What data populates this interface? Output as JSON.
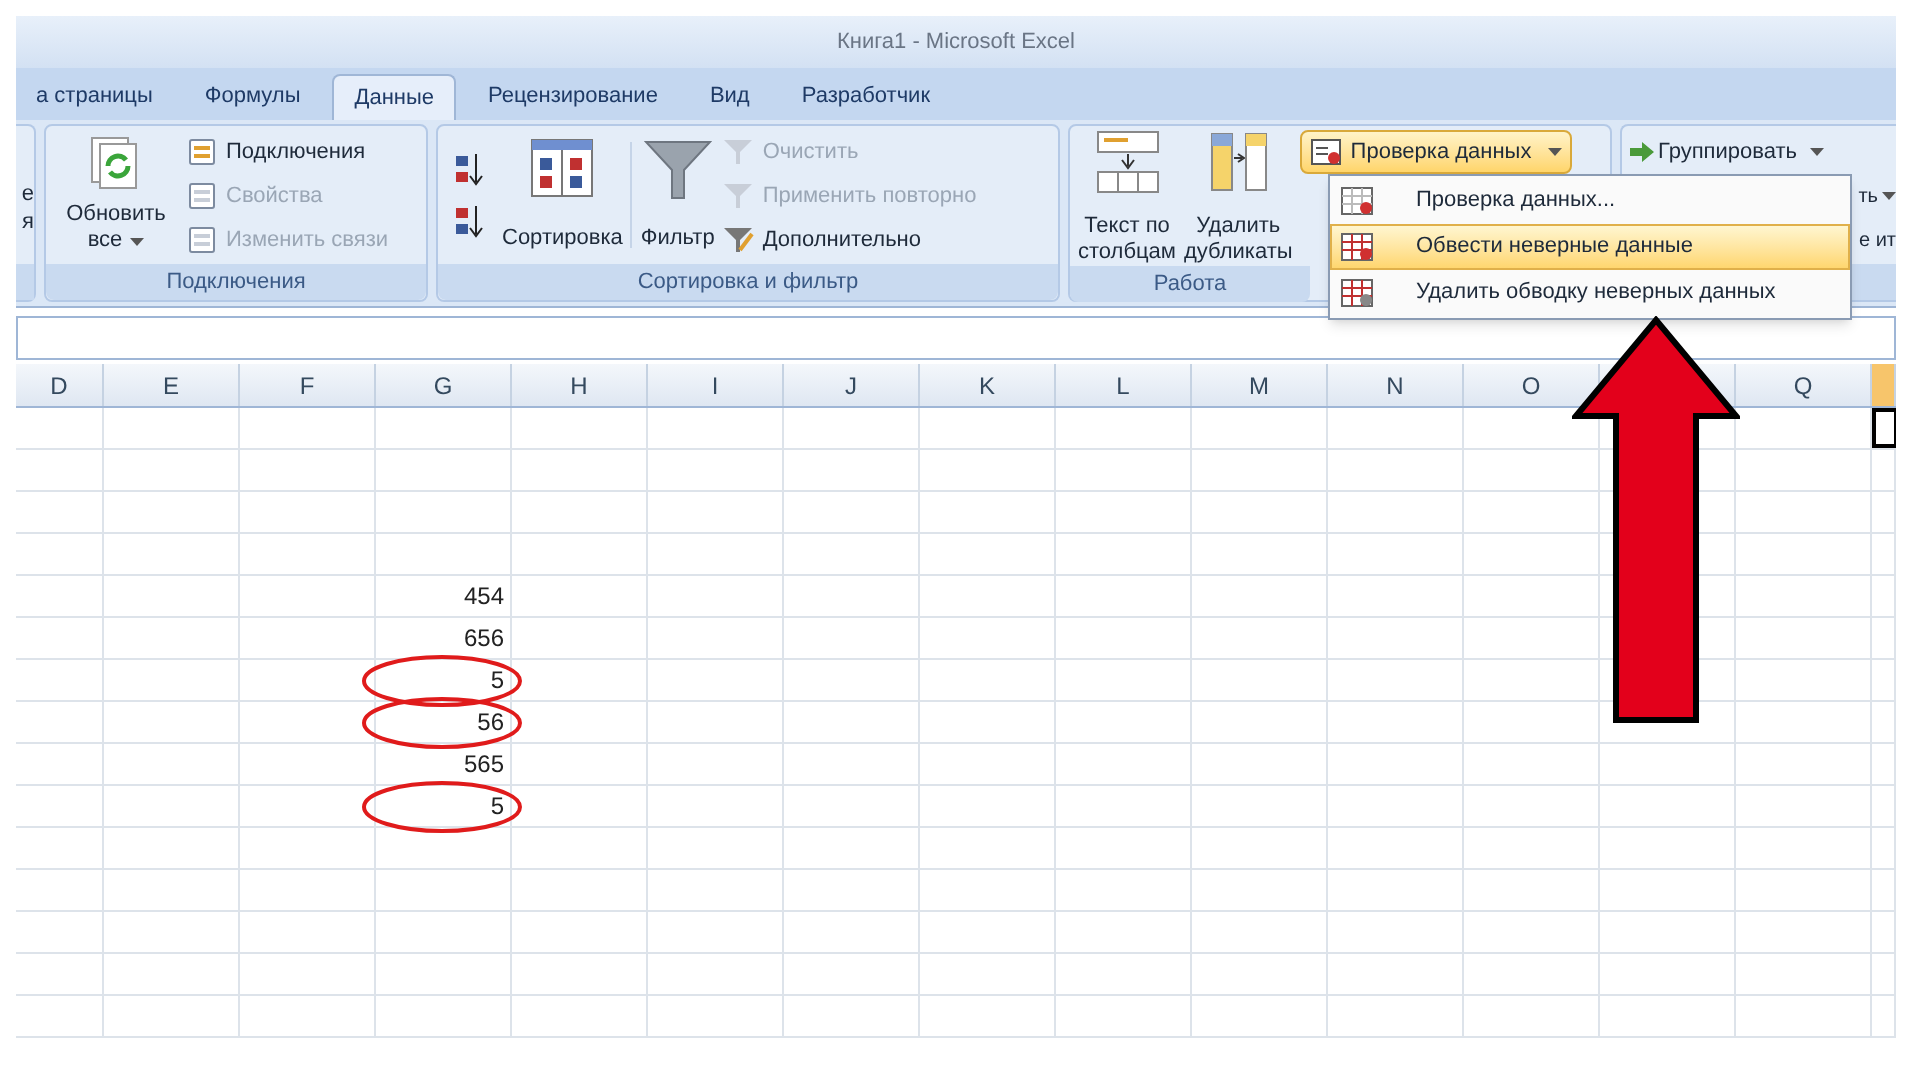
{
  "window": {
    "title": "Книга1 - Microsoft Excel"
  },
  "tabs": [
    {
      "label": "а страницы",
      "selected": false
    },
    {
      "label": "Формулы",
      "selected": false
    },
    {
      "label": "Данные",
      "selected": true
    },
    {
      "label": "Рецензирование",
      "selected": false
    },
    {
      "label": "Вид",
      "selected": false
    },
    {
      "label": "Разработчик",
      "selected": false
    }
  ],
  "partial_group": {
    "labels": [
      "е",
      "я"
    ]
  },
  "connections_group": {
    "label": "Подключения",
    "refresh_button": {
      "lines": [
        "Обновить",
        "все"
      ]
    },
    "items": [
      {
        "label": "Подключения",
        "disabled": false
      },
      {
        "label": "Свойства",
        "disabled": true
      },
      {
        "label": "Изменить связи",
        "disabled": true
      }
    ]
  },
  "sort_filter_group": {
    "label": "Сортировка и фильтр",
    "sort_button": "Сортировка",
    "filter_button": "Фильтр",
    "items": [
      {
        "label": "Очистить",
        "disabled": true
      },
      {
        "label": "Применить повторно",
        "disabled": true
      },
      {
        "label": "Дополнительно",
        "disabled": false
      }
    ]
  },
  "data_tools_group": {
    "label": "Работа",
    "text_to_columns": [
      "Текст по",
      "столбцам"
    ],
    "remove_duplicates": [
      "Удалить",
      "дубликаты"
    ],
    "validation_button": {
      "label": "Проверка данных",
      "highlighted": true
    }
  },
  "outline_group": {
    "items": [
      {
        "label": "Группировать",
        "kind": "icon-dropdown"
      },
      {
        "label": "ть",
        "kind": "dropdown"
      },
      {
        "label": "е ит",
        "kind": "plain"
      }
    ]
  },
  "validation_menu": {
    "items": [
      {
        "label": "Проверка данных...",
        "selected": false
      },
      {
        "label": "Обвести неверные данные",
        "selected": true
      },
      {
        "label": "Удалить обводку неверных данных",
        "selected": false
      }
    ]
  },
  "columns": [
    {
      "label": "D",
      "selected": false
    },
    {
      "label": "E",
      "selected": false
    },
    {
      "label": "F",
      "selected": false
    },
    {
      "label": "G",
      "selected": false
    },
    {
      "label": "H",
      "selected": false
    },
    {
      "label": "I",
      "selected": false
    },
    {
      "label": "J",
      "selected": false
    },
    {
      "label": "K",
      "selected": false
    },
    {
      "label": "L",
      "selected": false
    },
    {
      "label": "M",
      "selected": false
    },
    {
      "label": "N",
      "selected": false
    },
    {
      "label": "O",
      "selected": false
    },
    {
      "selected": false
    },
    {
      "label": "Q",
      "selected": false
    },
    {
      "selected": true
    }
  ],
  "cells": [
    {
      "value": "454",
      "circled": false
    },
    {
      "value": "656",
      "circled": false
    },
    {
      "value": "5",
      "circled": true
    },
    {
      "value": "56",
      "circled": true
    },
    {
      "value": "565",
      "circled": false
    },
    {
      "value": "5",
      "circled": true
    }
  ]
}
